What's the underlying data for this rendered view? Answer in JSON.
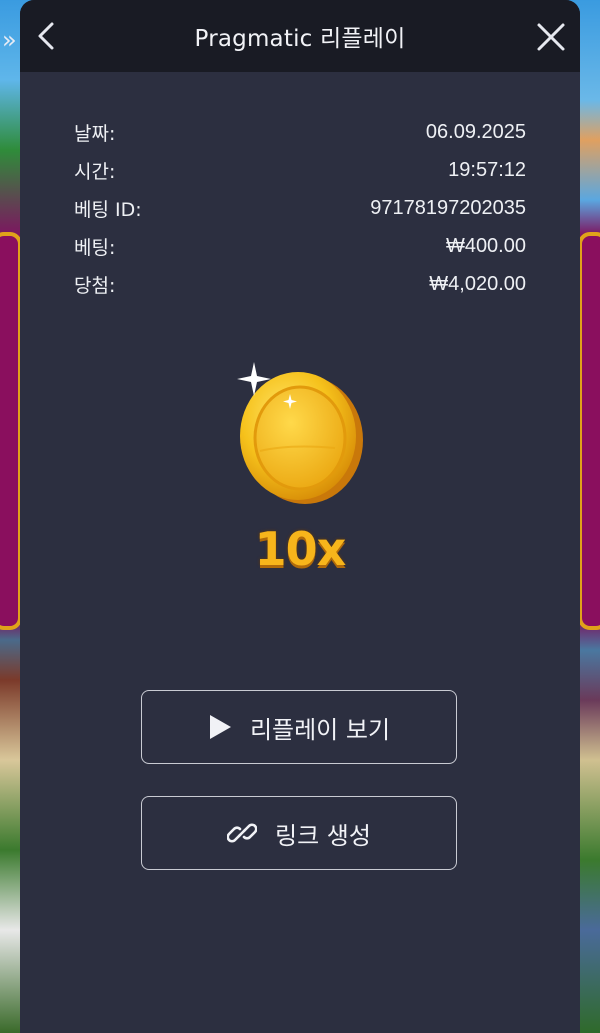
{
  "side_nav": {
    "expand_glyph": "»"
  },
  "header": {
    "title": "Pragmatic 리플레이"
  },
  "details": [
    {
      "label": "날짜:",
      "value": "06.09.2025"
    },
    {
      "label": "시간:",
      "value": "19:57:12"
    },
    {
      "label": "베팅 ID:",
      "value": "97178197202035"
    },
    {
      "label": "베팅:",
      "value": "₩400.00"
    },
    {
      "label": "당첨:",
      "value": "₩4,020.00"
    }
  ],
  "result": {
    "multiplier": "10x",
    "icon": "gold-coin-icon"
  },
  "actions": {
    "replay_label": "리플레이 보기",
    "link_label": "링크 생성"
  },
  "colors": {
    "panel": "#2c2f40",
    "header": "#191b24",
    "multiplier": "#f7b51b"
  }
}
